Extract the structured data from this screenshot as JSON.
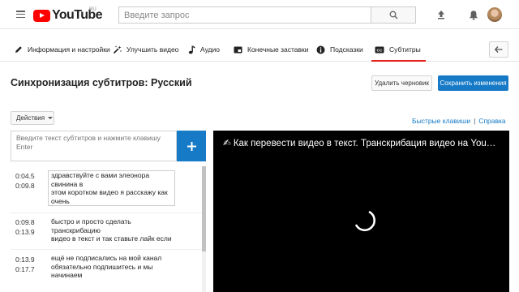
{
  "header": {
    "logo_text": "YouTube",
    "region": "RU",
    "search_placeholder": "Введите запрос",
    "icons": [
      "menu-icon",
      "search-icon",
      "upload-icon",
      "bell-icon",
      "avatar"
    ]
  },
  "tabs": [
    {
      "label": "Информация и настройки",
      "icon": "pencil-icon"
    },
    {
      "label": "Улучшить видео",
      "icon": "magic-wand-icon"
    },
    {
      "label": "Аудио",
      "icon": "music-note-icon"
    },
    {
      "label": "Конечные заставки",
      "icon": "end-screen-icon"
    },
    {
      "label": "Подсказки",
      "icon": "info-icon"
    },
    {
      "label": "Субтитры",
      "icon": "cc-icon",
      "active": true
    }
  ],
  "editor": {
    "title": "Синхронизация субтитров: Русский",
    "discard_label": "Удалить черновик",
    "save_label": "Сохранить изменения",
    "actions_label": "Действия",
    "shortcuts_link": "Быстрые клавиши",
    "separator": "|",
    "help_link": "Справка",
    "input_placeholder": "Введите текст субтитров и нажмите клавишу Enter",
    "add_label": "+"
  },
  "subtitles": [
    {
      "start": "0:04.5",
      "end": "0:09.8",
      "lines": [
        "здравствуйте с вами элеонора",
        "свинина в",
        "этом коротком видео я расскажу как",
        "очень"
      ]
    },
    {
      "start": "0:09.8",
      "end": "0:13.9",
      "lines": [
        "быстро и просто сделать",
        "транскрибацию",
        "видео в текст и так ставьте лайк если"
      ]
    },
    {
      "start": "0:13.9",
      "end": "0:17.7",
      "lines": [
        "ещё не подписались на мой канал",
        "обязательно подпишитесь и мы",
        "начинаем"
      ]
    }
  ],
  "player": {
    "title": "✍ Как перевести видео в текст. Транскрибация видео на You…"
  },
  "colors": {
    "brand_red": "#ff0000",
    "accent_blue": "#167ac6",
    "active_tab_underline": "#e62117"
  }
}
